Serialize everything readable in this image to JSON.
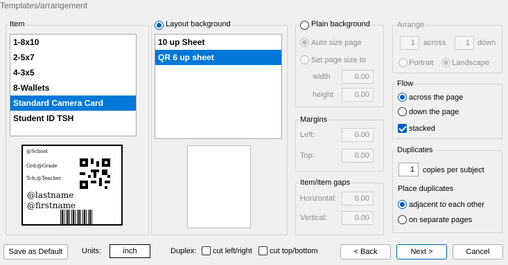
{
  "window": {
    "title": "Templates/arrangement"
  },
  "item_group": {
    "legend": "Item",
    "items": [
      {
        "label": "1-8x10",
        "selected": false
      },
      {
        "label": "2-5x7",
        "selected": false
      },
      {
        "label": "4-3x5",
        "selected": false
      },
      {
        "label": "8-Wallets",
        "selected": false
      },
      {
        "label": "Standard Camera Card",
        "selected": true
      },
      {
        "label": "Student ID TSH",
        "selected": false
      }
    ],
    "preview": {
      "line1": "@School",
      "line2": "Grd:@Grade",
      "line3": "Tch:@Teacher",
      "line4": "@lastname",
      "line5": "@firstname"
    }
  },
  "layout_group": {
    "radio_label": "Layout background",
    "selected": true,
    "items": [
      {
        "label": "10 up Sheet",
        "selected": false
      },
      {
        "label": "QR 6 up sheet",
        "selected": true
      }
    ]
  },
  "plain_group": {
    "radio_label": "Plain background",
    "auto_size": "Auto size page",
    "set_size": "Set page size to",
    "width_label": "width",
    "width_value": "0.00",
    "height_label": "height",
    "height_value": "0.00"
  },
  "margins_group": {
    "legend": "Margins",
    "left_label": "Left:",
    "left_value": "0.00",
    "top_label": "Top:",
    "top_value": "0.00"
  },
  "gaps_group": {
    "legend": "Item/item gaps",
    "horizontal_label": "Horizontal:",
    "horizontal_value": "0.00",
    "vertical_label": "Vertical:",
    "vertical_value": "0.00"
  },
  "arrange_group": {
    "legend": "Arrange",
    "across_value": "1",
    "across_label": "across",
    "down_value": "1",
    "down_label": "down",
    "portrait": "Portrait",
    "landscape": "Landscape"
  },
  "flow_group": {
    "legend": "Flow",
    "across": "across the page",
    "down": "down the page",
    "stacked": "stacked"
  },
  "duplicates_group": {
    "legend": "Duplicates",
    "copies_value": "1",
    "copies_label": "copies per subject",
    "place_label": "Place duplicates",
    "adjacent": "adjacent to each other",
    "separate": "on separate pages"
  },
  "footer": {
    "save_default": "Save as Default",
    "units_label": "Units:",
    "units_value": "inch",
    "duplex_label": "Duplex:",
    "cut_lr": "cut left/right",
    "cut_tb": "cut top/bottom",
    "back": "< Back",
    "next": "Next >",
    "cancel": "Cancel"
  }
}
